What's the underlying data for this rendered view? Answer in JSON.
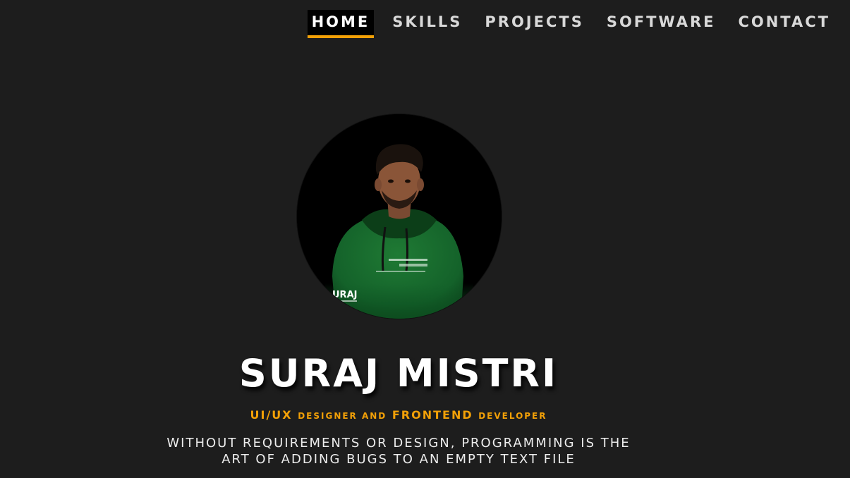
{
  "nav": {
    "items": [
      {
        "label": "HOME",
        "active": true
      },
      {
        "label": "SKILLS",
        "active": false
      },
      {
        "label": "PROJECTS",
        "active": false
      },
      {
        "label": "SOFTWARE",
        "active": false
      },
      {
        "label": "CONTACT",
        "active": false
      }
    ]
  },
  "hero": {
    "avatar_icon": "profile-photo",
    "photo_watermark": "URAJ",
    "name": "SURAJ MISTRI",
    "role": {
      "part1": "UI/UX",
      "part2": "DESIGNER AND",
      "part3": "FRONTEND",
      "part4": "DEVELOPER"
    },
    "quote_line1": "WITHOUT REQUIREMENTS OR DESIGN, PROGRAMMING IS THE",
    "quote_line2": "ART OF ADDING BUGS TO AN EMPTY TEXT FILE"
  },
  "colors": {
    "background": "#1d1d1d",
    "accent": "#f2a007",
    "nav_text": "#d9d9d9",
    "active_bg": "#000000"
  }
}
